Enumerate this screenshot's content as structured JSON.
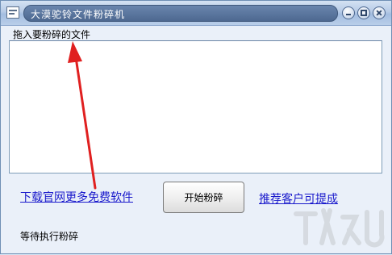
{
  "window": {
    "title": "大漠驼铃文件粉碎机"
  },
  "dropzone": {
    "label": "拖入要粉碎的文件"
  },
  "links": {
    "download": "下载官网更多免费软件",
    "recommend": "推荐客户可提成"
  },
  "actions": {
    "start_label": "开始粉碎"
  },
  "status": {
    "text": "等待执行粉碎"
  },
  "colors": {
    "link": "#1a1acc",
    "arrow": "#e02020",
    "titlebar": "#4d6890"
  },
  "icons": [
    "app-icon",
    "minimize-icon",
    "maximize-icon",
    "close-icon",
    "arrow-annotation",
    "watermark-logo"
  ]
}
